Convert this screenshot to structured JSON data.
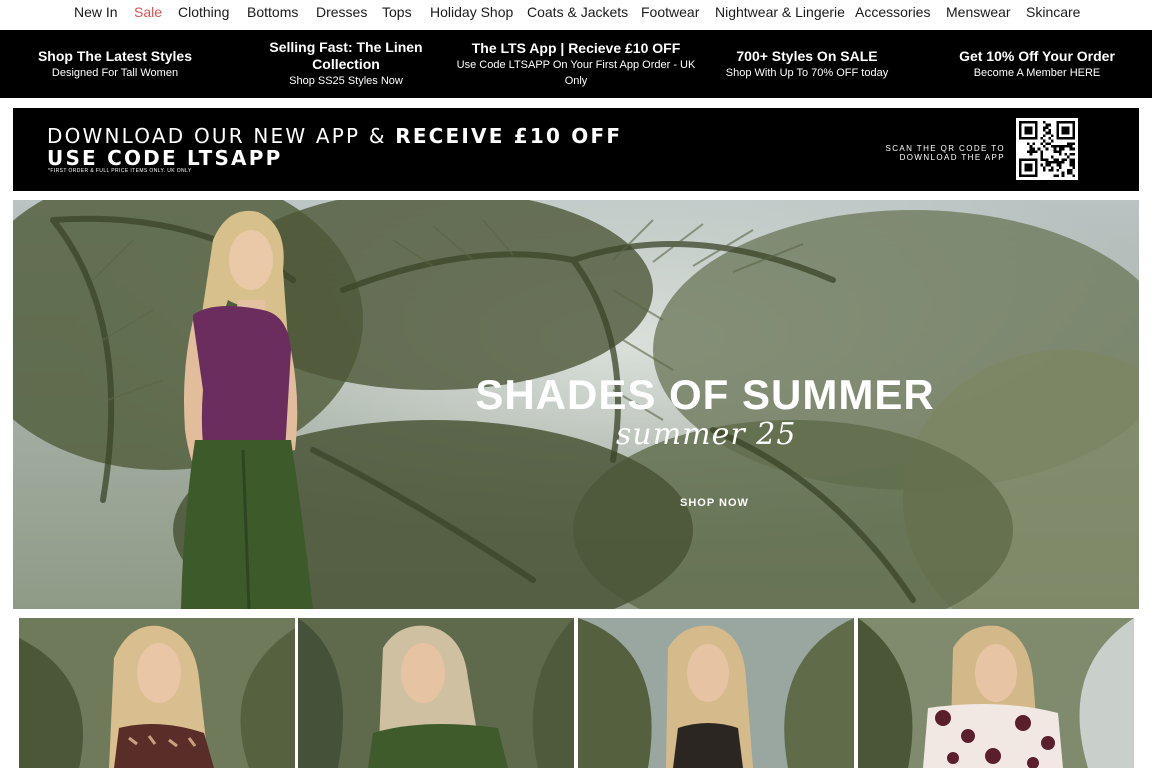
{
  "nav": {
    "items": [
      {
        "label": "New In"
      },
      {
        "label": "Sale"
      },
      {
        "label": "Clothing"
      },
      {
        "label": "Bottoms"
      },
      {
        "label": "Dresses"
      },
      {
        "label": "Tops"
      },
      {
        "label": "Holiday Shop"
      },
      {
        "label": "Coats & Jackets"
      },
      {
        "label": "Footwear"
      },
      {
        "label": "Nightwear & Lingerie"
      },
      {
        "label": "Accessories"
      },
      {
        "label": "Menswear"
      },
      {
        "label": "Skincare"
      }
    ],
    "sale_color": "#d9534f"
  },
  "promo": [
    {
      "title": "Shop The Latest Styles",
      "sub": "Designed For Tall Women"
    },
    {
      "title": "Selling Fast: The Linen Collection",
      "sub": "Shop SS25 Styles Now"
    },
    {
      "title": "The LTS App | Recieve £10 OFF",
      "sub": "Use Code LTSAPP On Your First App Order - UK Only"
    },
    {
      "title": "700+ Styles On SALE",
      "sub": "Shop With Up To 70% OFF today"
    },
    {
      "title": "Get 10% Off Your Order",
      "sub": "Become A Member HERE"
    }
  ],
  "app_banner": {
    "line1_light": "DOWNLOAD OUR NEW APP & ",
    "line1_bold": "RECEIVE £10 OFF",
    "line2": "USE CODE LTSAPP",
    "fine_print": "*FIRST ORDER & FULL PRICE ITEMS ONLY. UK ONLY",
    "scan_text": "SCAN THE QR CODE TO DOWNLOAD THE APP",
    "qr_icon": "qr-code-icon"
  },
  "hero": {
    "title": "SHADES OF SUMMER",
    "script": "summer 25",
    "cta": "SHOP NOW"
  },
  "colors": {
    "promo_bg": "#000000",
    "palm_green": "#3f4a2c",
    "top_purple": "#6b2c5e",
    "trouser_green": "#3d5a2a"
  }
}
